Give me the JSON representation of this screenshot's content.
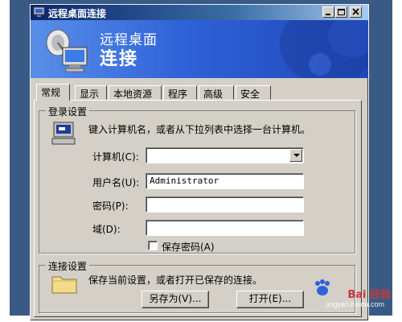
{
  "window": {
    "title": "远程桌面连接",
    "banner_line1": "远程桌面",
    "banner_line2": "连接"
  },
  "tabs": [
    {
      "label": "常规",
      "active": true
    },
    {
      "label": "显示",
      "active": false
    },
    {
      "label": "本地资源",
      "active": false
    },
    {
      "label": "程序",
      "active": false
    },
    {
      "label": "高级",
      "active": false
    },
    {
      "label": "安全",
      "active": false
    }
  ],
  "login": {
    "legend": "登录设置",
    "instruction": "键入计算机名，或者从下拉列表中选择一台计算机。",
    "computer_label": "计算机(C):",
    "computer_value": "",
    "username_label": "用户名(U):",
    "username_value": "Administrator",
    "password_label": "密码(P):",
    "password_value": "",
    "domain_label": "域(D):",
    "domain_value": "",
    "save_password_label": "保存密码(A)",
    "save_password_checked": false
  },
  "connection": {
    "legend": "连接设置",
    "description": "保存当前设置，或者打开已保存的连接。",
    "save_as_label": "另存为(V)...",
    "open_label": "打开(E)..."
  },
  "watermark": {
    "text": "Bai 经验",
    "sub": "jingyan.baidu.com"
  },
  "colors": {
    "title_bar": "#0a246a",
    "banner": "#2f62d8",
    "dialog": "#d4d0c8",
    "frame": "#3a5a86"
  }
}
